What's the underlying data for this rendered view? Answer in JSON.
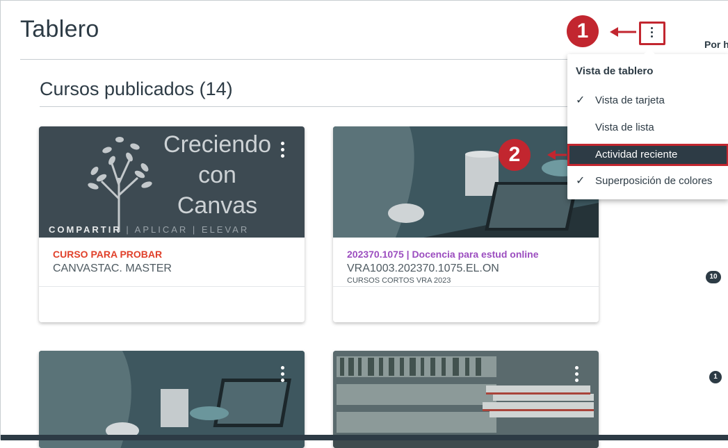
{
  "header": {
    "title": "Tablero",
    "right_label": "Por h"
  },
  "section": {
    "title": "Cursos publicados (14)"
  },
  "cards": [
    {
      "hero_text": [
        "Creciendo",
        "con",
        "Canvas"
      ],
      "tagline_bold": "COMPARTIR",
      "tagline_rest": "| APLICAR | ELEVAR",
      "code": "CURSO PARA PROBAR",
      "code_color": "#e0402a",
      "name": "CANVASTAC. MASTER",
      "term": ""
    },
    {
      "code": "202370.1075 | Docencia para estud online",
      "code_color": "#9b4dbf",
      "name": "VRA1003.202370.1075.EL.ON",
      "term": "CURSOS CORTOS VRA 2023"
    },
    {
      "code": "",
      "name": "",
      "term": ""
    },
    {
      "code": "",
      "name": "",
      "term": ""
    }
  ],
  "badges": [
    "10",
    "1"
  ],
  "callouts": [
    "1",
    "2"
  ],
  "menu": {
    "heading": "Vista de tablero",
    "items": [
      {
        "label": "Vista de tarjeta",
        "checked": true
      },
      {
        "label": "Vista de lista",
        "checked": false
      },
      {
        "label": "Actividad reciente",
        "checked": false,
        "highlighted": true
      },
      {
        "label": "Superposición de colores",
        "checked": true
      }
    ],
    "check_glyph": "✓"
  },
  "colors": {
    "accent_red": "#c2262f",
    "dark": "#2d3b45"
  }
}
